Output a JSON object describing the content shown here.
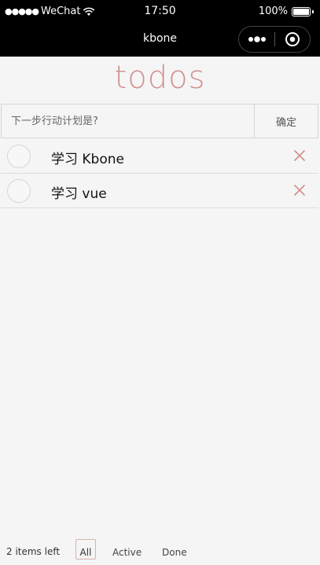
{
  "status_bar": {
    "carrier": "WeChat",
    "time": "17:50",
    "battery": "100%"
  },
  "nav": {
    "title": "kbone"
  },
  "app": {
    "title": "todos"
  },
  "input": {
    "placeholder": "下一步行动计划是?",
    "value": "",
    "confirm_label": "确定"
  },
  "todos": [
    {
      "label": "学习 Kbone",
      "completed": false
    },
    {
      "label": "学习 vue",
      "completed": false
    }
  ],
  "footer": {
    "items_left": "2 items left",
    "filters": {
      "all": "All",
      "active": "Active",
      "done": "Done"
    },
    "selected_filter": "All"
  },
  "colors": {
    "accent": "#d28a8a",
    "background": "#f5f5f5",
    "bar": "#000000"
  }
}
